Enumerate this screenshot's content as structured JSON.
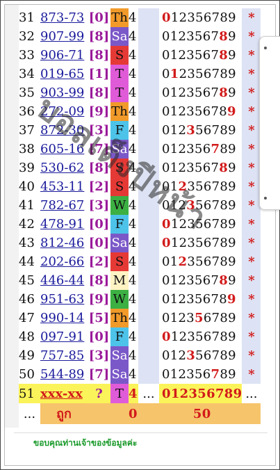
{
  "rows": [
    {
      "no": "31",
      "num": "873-73",
      "mon": "[0]",
      "day": "Th",
      "four": "4",
      "digits": [
        [
          "0",
          true
        ],
        [
          "12356789",
          false
        ]
      ],
      "star": "*"
    },
    {
      "no": "32",
      "num": "907-99",
      "mon": "[8]",
      "day": "Sa",
      "four": "4",
      "digits": [
        [
          "0123567",
          false
        ],
        [
          "8",
          true
        ],
        [
          "9",
          false
        ]
      ],
      "star": "*"
    },
    {
      "no": "33",
      "num": "906-71",
      "mon": "[8]",
      "day": "S",
      "four": "4",
      "digits": [
        [
          "0123567",
          false
        ],
        [
          "8",
          true
        ],
        [
          "9",
          false
        ]
      ],
      "star": "*"
    },
    {
      "no": "34",
      "num": "019-65",
      "mon": "[1]",
      "day": "T",
      "four": "4",
      "digits": [
        [
          "0",
          false
        ],
        [
          "1",
          true
        ],
        [
          "2356789",
          false
        ]
      ],
      "star": "*"
    },
    {
      "no": "35",
      "num": "903-99",
      "mon": "[8]",
      "day": "T",
      "four": "4",
      "digits": [
        [
          "0123567",
          false
        ],
        [
          "8",
          true
        ],
        [
          "9",
          false
        ]
      ],
      "star": "*"
    },
    {
      "no": "36",
      "num": "272-09",
      "mon": "[9]",
      "day": "Th",
      "four": "4",
      "digits": [
        [
          "01235678",
          false
        ],
        [
          "9",
          true
        ]
      ],
      "star": "*"
    },
    {
      "no": "37",
      "num": "872-30",
      "mon": "[3]",
      "day": "F",
      "four": "4",
      "digits": [
        [
          "012",
          false
        ],
        [
          "3",
          true
        ],
        [
          "56789",
          false
        ]
      ],
      "star": "*"
    },
    {
      "no": "38",
      "num": "605-16",
      "mon": "[7]",
      "day": "Sa",
      "four": "4",
      "digits": [
        [
          "012356",
          false
        ],
        [
          "7",
          true
        ],
        [
          "89",
          false
        ]
      ],
      "star": "*"
    },
    {
      "no": "39",
      "num": "530-62",
      "mon": "[8]",
      "day": "S",
      "four": "4",
      "digits": [
        [
          "0123567",
          false
        ],
        [
          "8",
          true
        ],
        [
          "9",
          false
        ]
      ],
      "star": "*"
    },
    {
      "no": "40",
      "num": "453-11",
      "mon": "[2]",
      "day": "S",
      "four": "4",
      "digits": [
        [
          "01",
          false
        ],
        [
          "2",
          true
        ],
        [
          "356789",
          false
        ]
      ],
      "star": "*"
    },
    {
      "no": "41",
      "num": "782-67",
      "mon": "[3]",
      "day": "W",
      "four": "4",
      "digits": [
        [
          "012",
          false
        ],
        [
          "3",
          true
        ],
        [
          "56789",
          false
        ]
      ],
      "star": "*"
    },
    {
      "no": "42",
      "num": "478-91",
      "mon": "[0]",
      "day": "F",
      "four": "4",
      "digits": [
        [
          "0",
          true
        ],
        [
          "12356789",
          false
        ]
      ],
      "star": "*"
    },
    {
      "no": "43",
      "num": "812-46",
      "mon": "[0]",
      "day": "Sa",
      "four": "4",
      "digits": [
        [
          "0",
          true
        ],
        [
          "12356789",
          false
        ]
      ],
      "star": "*"
    },
    {
      "no": "44",
      "num": "202-66",
      "mon": "[2]",
      "day": "S",
      "four": "4",
      "digits": [
        [
          "01",
          false
        ],
        [
          "2",
          true
        ],
        [
          "356789",
          false
        ]
      ],
      "star": "*"
    },
    {
      "no": "45",
      "num": "446-44",
      "mon": "[8]",
      "day": "M",
      "four": "4",
      "digits": [
        [
          "0123567",
          false
        ],
        [
          "8",
          true
        ],
        [
          "9",
          false
        ]
      ],
      "star": "*"
    },
    {
      "no": "46",
      "num": "951-63",
      "mon": "[9]",
      "day": "W",
      "four": "4",
      "digits": [
        [
          "01235678",
          false
        ],
        [
          "9",
          true
        ]
      ],
      "star": "*"
    },
    {
      "no": "47",
      "num": "990-14",
      "mon": "[5]",
      "day": "Th",
      "four": "4",
      "digits": [
        [
          "0123",
          false
        ],
        [
          "5",
          true
        ],
        [
          "6789",
          false
        ]
      ],
      "star": "*"
    },
    {
      "no": "48",
      "num": "097-91",
      "mon": "[0]",
      "day": "F",
      "four": "4",
      "digits": [
        [
          "0",
          true
        ],
        [
          "12356789",
          false
        ]
      ],
      "star": "*"
    },
    {
      "no": "49",
      "num": "757-85",
      "mon": "[3]",
      "day": "Sa",
      "four": "4",
      "digits": [
        [
          "012",
          false
        ],
        [
          "3",
          true
        ],
        [
          "56789",
          false
        ]
      ],
      "star": "*"
    },
    {
      "no": "50",
      "num": "544-89",
      "mon": "[7]",
      "day": "Sa",
      "four": "4",
      "digits": [
        [
          "012356",
          false
        ],
        [
          "7",
          true
        ],
        [
          "89",
          false
        ]
      ],
      "star": "*"
    }
  ],
  "prediction": {
    "no": "51",
    "num": "xxx-xx",
    "mon": "?",
    "day": "T",
    "four": "4",
    "gap": "...",
    "digits": "012356789",
    "star": "..."
  },
  "summary": {
    "dots": "...",
    "label": "ถูก",
    "zero": "0",
    "count": "50"
  },
  "footer": "ขอบคุณท่านเจ้าของข้อมูลค่ะ",
  "watermark": "บอลเต็งปีหน้า"
}
